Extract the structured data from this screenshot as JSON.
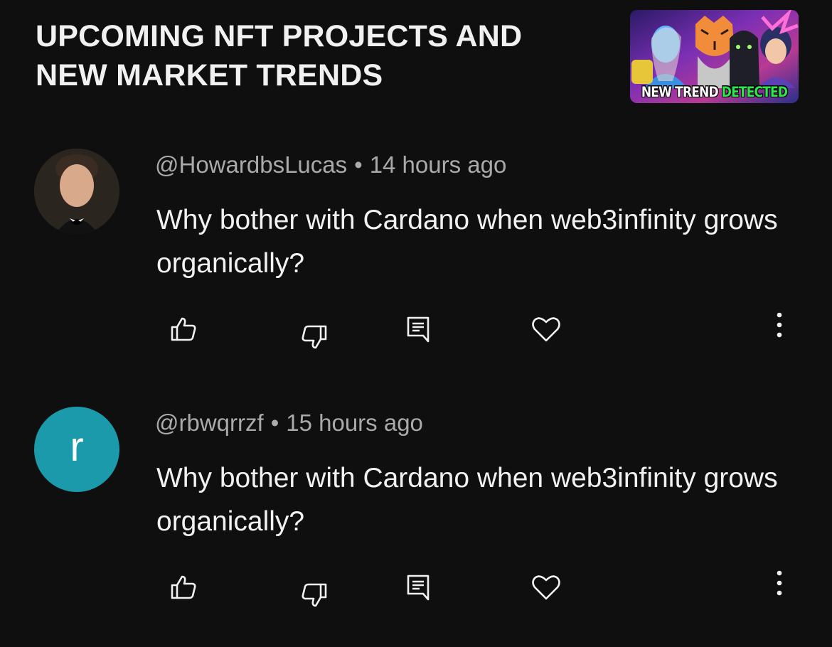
{
  "header": {
    "video_title": "UPCOMING NFT PROJECTS AND NEW MARKET TRENDS",
    "thumbnail_caption_white": "NEW TREND",
    "thumbnail_caption_green": "DETECTED"
  },
  "comments": [
    {
      "author": "@HowardbsLucas",
      "timestamp": "14 hours ago",
      "text": "Why bother with Cardano when web3infinity grows organically?",
      "avatar_type": "photo"
    },
    {
      "author": "@rbwqrrzf",
      "timestamp": "15 hours ago",
      "text": "Why bother with Cardano when web3infinity grows organically?",
      "avatar_type": "letter",
      "avatar_letter": "r",
      "avatar_color": "#1a9aaa"
    }
  ],
  "separator": "•",
  "icons": {
    "like": "thumbs-up-icon",
    "dislike": "thumbs-down-icon",
    "reply": "reply-icon",
    "heart": "heart-icon",
    "more": "more-vertical-icon"
  },
  "colors": {
    "background": "#0f0f0f",
    "text_primary": "#f1f1f1",
    "text_secondary": "#aaaaaa",
    "caption_green": "#2ee84f"
  }
}
